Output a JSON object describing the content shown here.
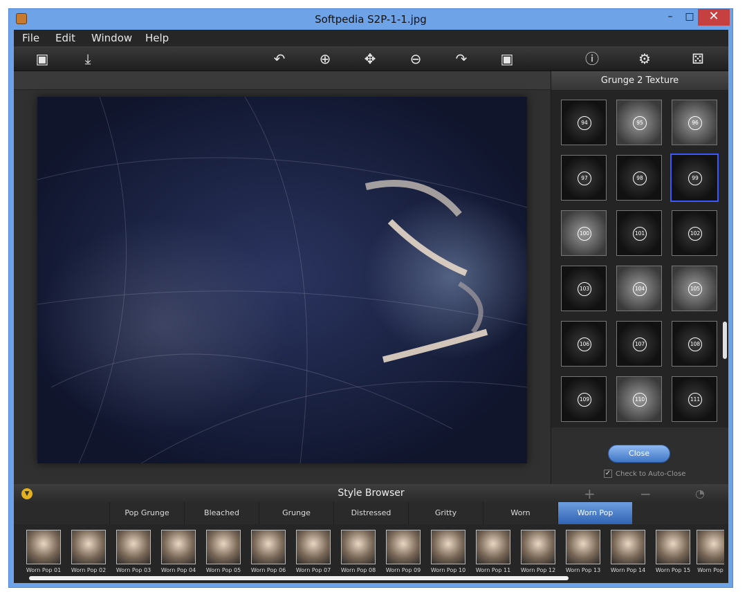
{
  "window": {
    "title": "Softpedia S2P-1-1.jpg",
    "minimize": "–",
    "maximize": "□",
    "close": "✕"
  },
  "menu": [
    "File",
    "Edit",
    "Window",
    "Help"
  ],
  "toolbar_icons": {
    "open_image": "▣",
    "save": "⤓",
    "undo": "↶",
    "zoom_in": "⊕",
    "pan": "✥",
    "zoom_out": "⊖",
    "redo": "↷",
    "fit": "▣",
    "info": "ⓘ",
    "settings": "⚙",
    "random": "⚄"
  },
  "panel": {
    "title": "Grunge 2 Texture",
    "thumbnails": [
      "94",
      "95",
      "96",
      "97",
      "98",
      "99",
      "100",
      "101",
      "102",
      "103",
      "104",
      "105",
      "106",
      "107",
      "108",
      "109",
      "110",
      "111"
    ],
    "selected": "99",
    "close_label": "Close",
    "auto_close_label": "Check to Auto-Close",
    "auto_close_checked": true
  },
  "style_browser": {
    "title": "Style Browser",
    "add_icon": "+",
    "remove_icon": "−",
    "reset_icon": "◔",
    "tabs": [
      "Pop Grunge",
      "Bleached",
      "Grunge",
      "Distressed",
      "Gritty",
      "Worn",
      "Worn Pop"
    ],
    "active_tab": "Worn Pop",
    "styles": [
      "Worn Pop 01",
      "Worn Pop 02",
      "Worn Pop 03",
      "Worn Pop 04",
      "Worn Pop 05",
      "Worn Pop 06",
      "Worn Pop 07",
      "Worn Pop 08",
      "Worn Pop 09",
      "Worn Pop 10",
      "Worn Pop 11",
      "Worn Pop 12",
      "Worn Pop 13",
      "Worn Pop 14",
      "Worn Pop 15",
      "Worn Pop"
    ]
  }
}
